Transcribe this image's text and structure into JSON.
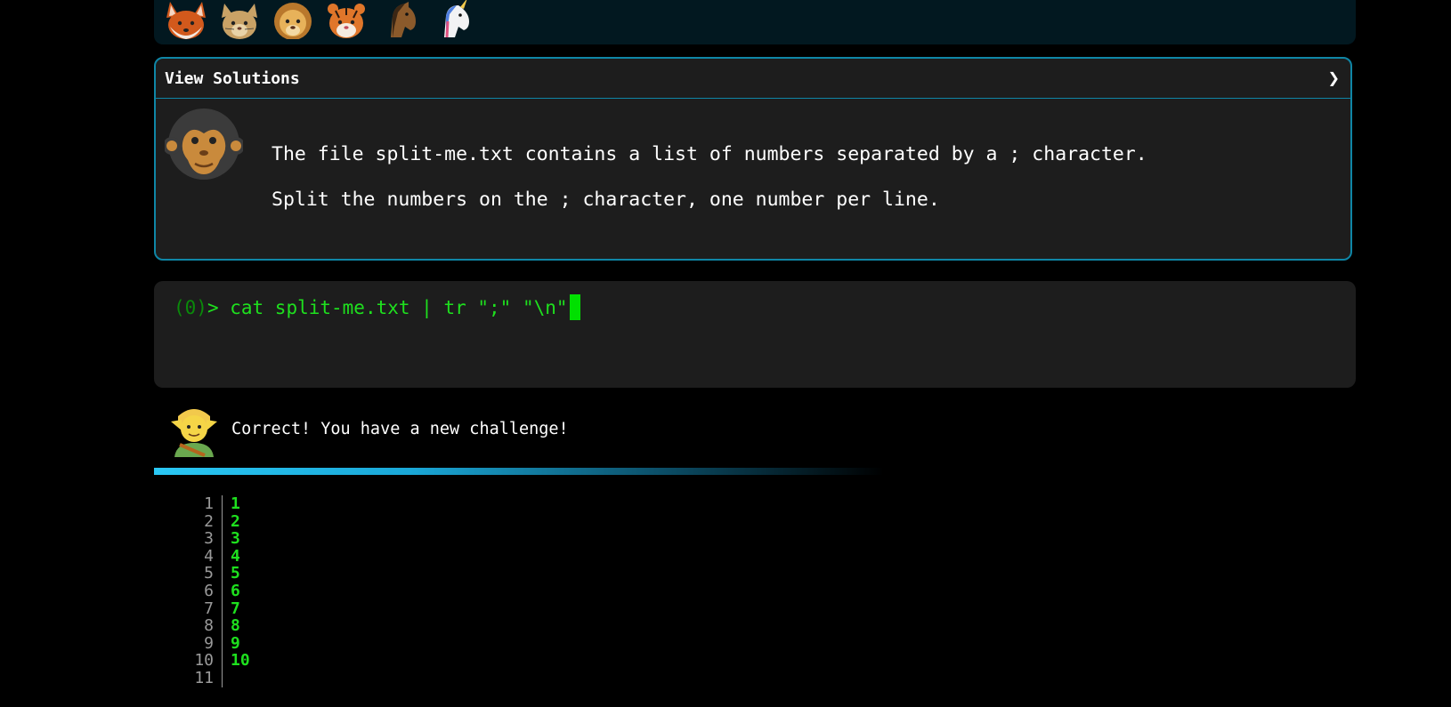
{
  "avatars": [
    {
      "icon": "fox-face-icon"
    },
    {
      "icon": "cat-face-icon"
    },
    {
      "icon": "lion-face-icon"
    },
    {
      "icon": "tiger-face-icon"
    },
    {
      "icon": "horse-face-icon"
    },
    {
      "icon": "unicorn-face-icon"
    }
  ],
  "solutions": {
    "title": "View Solutions",
    "chevron": "❯",
    "avatar_icon": "monkey-face-icon",
    "line1": "The file split-me.txt contains a list of numbers separated by a ; character.",
    "line2": "Split the numbers on the ; character, one number per line."
  },
  "terminal": {
    "status": "(0)",
    "prompt_symbol": "> ",
    "command": "cat split-me.txt | tr \";\" \"\\n\""
  },
  "feedback": {
    "avatar_icon": "elf-icon",
    "message": "Correct! You have a new challenge!"
  },
  "output": {
    "line_numbers": [
      "1",
      "2",
      "3",
      "4",
      "5",
      "6",
      "7",
      "8",
      "9",
      "10",
      "11"
    ],
    "lines": [
      "1",
      "2",
      "3",
      "4",
      "5",
      "6",
      "7",
      "8",
      "9",
      "10",
      ""
    ]
  },
  "colors": {
    "accent_border": "#0f86a6",
    "terminal_green": "#1ee01e",
    "progress_start": "#2ac8f5"
  }
}
